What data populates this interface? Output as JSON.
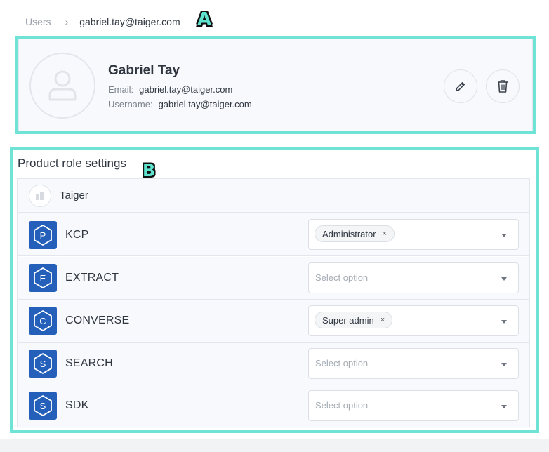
{
  "breadcrumb": {
    "root": "Users",
    "separator": "›",
    "current": "gabriel.tay@taiger.com"
  },
  "annotations": {
    "a": "A",
    "b": "B"
  },
  "profile": {
    "name": "Gabriel Tay",
    "email_label": "Email:",
    "email": "gabriel.tay@taiger.com",
    "username_label": "Username:",
    "username": "gabriel.tay@taiger.com",
    "avatar_icon": "user-icon",
    "edit_icon": "pencil-icon",
    "delete_icon": "trash-icon"
  },
  "roles": {
    "title": "Product role settings",
    "organization": "Taiger",
    "products": [
      {
        "letter": "P",
        "name": "KCP",
        "selected": "Administrator",
        "placeholder": ""
      },
      {
        "letter": "E",
        "name": "EXTRACT",
        "selected": "",
        "placeholder": "Select option"
      },
      {
        "letter": "C",
        "name": "CONVERSE",
        "selected": "Super admin",
        "placeholder": ""
      },
      {
        "letter": "S",
        "name": "SEARCH",
        "selected": "",
        "placeholder": "Select option"
      },
      {
        "letter": "S",
        "name": "SDK",
        "selected": "",
        "placeholder": "Select option"
      }
    ],
    "remove_glyph": "×"
  },
  "colors": {
    "annotation_border": "#6fe3d5",
    "product_icon_bg": "#2460ba"
  }
}
